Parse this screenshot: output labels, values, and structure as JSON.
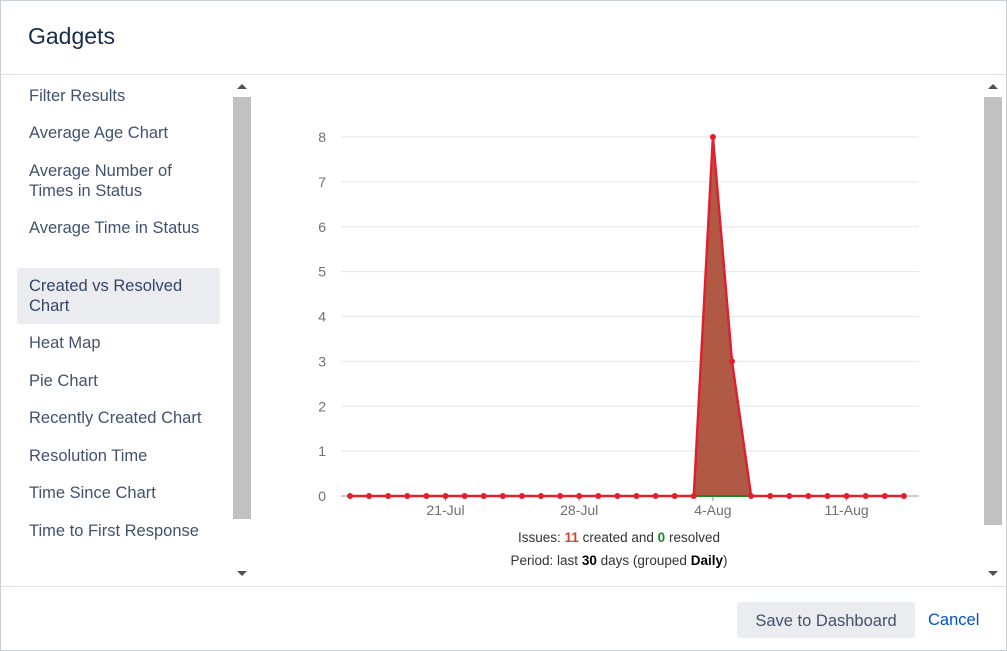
{
  "dialog": {
    "title": "Gadgets"
  },
  "sidebar": {
    "items": [
      {
        "label": "Filter Results",
        "active": false
      },
      {
        "label": "Average Age Chart",
        "active": false
      },
      {
        "label": "Average Number of Times in Status",
        "active": false
      },
      {
        "label": "Average Time in Status",
        "active": false
      },
      {
        "label": "Created vs Resolved Chart",
        "active": true
      },
      {
        "label": "Heat Map",
        "active": false
      },
      {
        "label": "Pie Chart",
        "active": false
      },
      {
        "label": "Recently Created Chart",
        "active": false
      },
      {
        "label": "Resolution Time",
        "active": false
      },
      {
        "label": "Time Since Chart",
        "active": false
      },
      {
        "label": "Time to First Response",
        "active": false
      }
    ]
  },
  "summary": {
    "issues_prefix": "Issues:",
    "created_count": "11",
    "created_text": "created and",
    "resolved_count": "0",
    "resolved_text": "resolved",
    "period_prefix": "Period: last",
    "period_days": "30",
    "period_mid": "days (grouped",
    "period_group": "Daily",
    "period_suffix": ")"
  },
  "footer": {
    "save_label": "Save to Dashboard",
    "cancel_label": "Cancel"
  },
  "colors": {
    "created": "#e0202f",
    "created_fill": "#b05a45",
    "resolved": "#14892c",
    "active_bg": "#ebecf0"
  },
  "chart_data": {
    "type": "area",
    "x": [
      "2019-07-16",
      "2019-07-17",
      "2019-07-18",
      "2019-07-19",
      "2019-07-20",
      "2019-07-21",
      "2019-07-22",
      "2019-07-23",
      "2019-07-24",
      "2019-07-25",
      "2019-07-26",
      "2019-07-27",
      "2019-07-28",
      "2019-07-29",
      "2019-07-30",
      "2019-07-31",
      "2019-08-01",
      "2019-08-02",
      "2019-08-03",
      "2019-08-04",
      "2019-08-05",
      "2019-08-06",
      "2019-08-07",
      "2019-08-08",
      "2019-08-09",
      "2019-08-10",
      "2019-08-11",
      "2019-08-12",
      "2019-08-13",
      "2019-08-14"
    ],
    "x_ticks": [
      "21-Jul",
      "28-Jul",
      "4-Aug",
      "11-Aug"
    ],
    "y_ticks": [
      0,
      1,
      2,
      3,
      4,
      5,
      6,
      7,
      8
    ],
    "ylim": [
      0,
      8
    ],
    "series": [
      {
        "name": "created",
        "values": [
          0,
          0,
          0,
          0,
          0,
          0,
          0,
          0,
          0,
          0,
          0,
          0,
          0,
          0,
          0,
          0,
          0,
          0,
          0,
          8,
          3,
          0,
          0,
          0,
          0,
          0,
          0,
          0,
          0,
          0
        ]
      },
      {
        "name": "resolved",
        "values": [
          0,
          0,
          0,
          0,
          0,
          0,
          0,
          0,
          0,
          0,
          0,
          0,
          0,
          0,
          0,
          0,
          0,
          0,
          0,
          0,
          0,
          0,
          0,
          0,
          0,
          0,
          0,
          0,
          0,
          0
        ]
      }
    ],
    "grid": true,
    "title": "",
    "xlabel": "",
    "ylabel": ""
  }
}
